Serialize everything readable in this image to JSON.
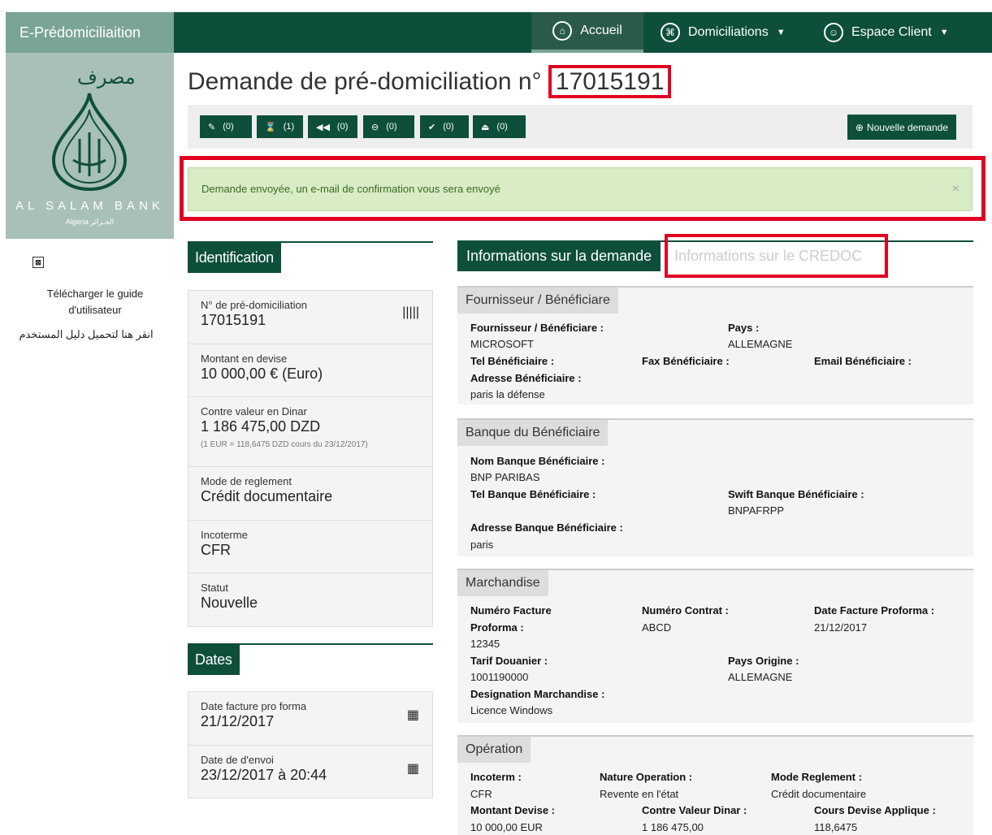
{
  "nav": {
    "brand": "E-Prédomiciliaition",
    "home": "Accueil",
    "domiciliations": "Domiciliations",
    "client": "Espace Client"
  },
  "logo": {
    "arabic": "مصرف",
    "name": "AL SALAM BANK",
    "country": "Algeria الجـزائر"
  },
  "sidebar": {
    "guide": "Télécharger le guide d'utilisateur",
    "guide_ar": "انقر هنا لتحميل دليل المستخدم"
  },
  "page": {
    "title_prefix": "Demande de pré-domiciliation n°",
    "number": "17015191"
  },
  "toolbar": {
    "counts": [
      "(0)",
      "(1)",
      "(0)",
      "(0)",
      "(0)",
      "(0)"
    ],
    "icons": [
      "edit-icon",
      "hourglass-icon",
      "backward-icon",
      "minus-icon",
      "check-icon",
      "eject-icon"
    ],
    "new": "Nouvelle demande"
  },
  "alert": {
    "text": "Demande envoyée, un e-mail de confirmation vous sera envoyé",
    "close": "×"
  },
  "ident": {
    "title": "Identification",
    "num_label": "N° de pré-domiciliation",
    "num_value": "17015191",
    "amount_label": "Montant en devise",
    "amount_value": "10 000,00 € (Euro)",
    "dinar_label": "Contre valeur en Dinar",
    "dinar_value": "1 186 475,00 DZD",
    "dinar_note": "(1 EUR = 118,6475 DZD cours du 23/12/2017)",
    "mode_label": "Mode de reglement",
    "mode_value": "Crédit documentaire",
    "inco_label": "Incoterme",
    "inco_value": "CFR",
    "status_label": "Statut",
    "status_value": "Nouvelle"
  },
  "dates": {
    "title": "Dates",
    "invoice_label": "Date facture pro forma",
    "invoice_value": "21/12/2017",
    "send_label": "Date de d'envoi",
    "send_value": "23/12/2017 à 20:44"
  },
  "tabs": {
    "active": "Informations sur la demande",
    "other": "Informations sur le CREDOC"
  },
  "supplier": {
    "title": "Fournisseur / Bénéficiare",
    "name_l": "Fournisseur / Bénéficiare :",
    "name_v": "MICROSOFT",
    "country_l": "Pays :",
    "country_v": "ALLEMAGNE",
    "tel_l": "Tel Bénéficiaire :",
    "fax_l": "Fax Bénéficiaire :",
    "email_l": "Email Bénéficiaire :",
    "addr_l": "Adresse Bénéficiaire :",
    "addr_v": "paris la défense"
  },
  "bank": {
    "title": "Banque du Bénéficiaire",
    "name_l": "Nom Banque Bénéficiaire :",
    "name_v": "BNP PARIBAS",
    "tel_l": "Tel Banque Bénéficiaire :",
    "swift_l": "Swift Banque Bénéficiaire :",
    "swift_v": "BNPAFRPP",
    "addr_l": "Adresse Banque Bénéficiaire :",
    "addr_v": "paris"
  },
  "goods": {
    "title": "Marchandise",
    "inv_l1": "Numéro Facture",
    "inv_l2": "Proforma :",
    "inv_v": "12345",
    "contract_l": "Numéro Contrat :",
    "contract_v": "ABCD",
    "date_l": "Date Facture Proforma :",
    "date_v": "21/12/2017",
    "tarif_l": "Tarif Douanier :",
    "tarif_v": "1001190000",
    "origin_l": "Pays Origine :",
    "origin_v": "ALLEMAGNE",
    "desig_l": "Designation Marchandise :",
    "desig_v": "Licence Windows"
  },
  "op": {
    "title": "Opération",
    "inco_l": "Incoterm :",
    "inco_v": "CFR",
    "nature_l": "Nature Operation :",
    "nature_v": "Revente en l'état",
    "mode_l": "Mode Reglement :",
    "mode_v": "Crédit documentaire",
    "amount_l": "Montant Devise :",
    "amount_v": "10 000,00 EUR",
    "dinar_l": "Contre Valeur Dinar :",
    "dinar_v": "1 186 475,00",
    "rate_l": "Cours Devise Applique :",
    "rate_v": "118,6475"
  }
}
